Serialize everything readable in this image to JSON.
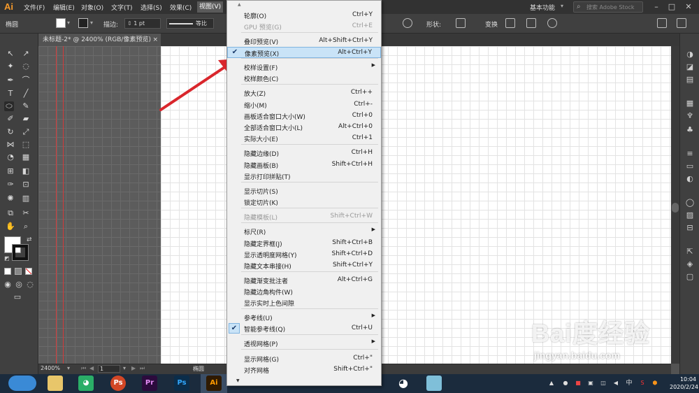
{
  "app": {
    "logo": "Ai",
    "workspace": "基本功能",
    "stock_placeholder": "搜索 Adobe Stock"
  },
  "menubar": {
    "items": [
      "文件(F)",
      "编辑(E)",
      "对象(O)",
      "文字(T)",
      "选择(S)",
      "效果(C)",
      "视图(V)"
    ],
    "active": "视图(V)"
  },
  "controlbar": {
    "object_label": "椭圆",
    "stroke_label": "描边:",
    "stroke_value": "1 pt",
    "stroke_profile": "等比",
    "shape_label": "形状:",
    "transform_label": "变换"
  },
  "document": {
    "tab_title": "未标题-2* @ 2400% (RGB/像素预览)",
    "close_glyph": "×"
  },
  "statusbar": {
    "zoom": "2400%",
    "page": "1",
    "tool": "椭圆"
  },
  "view_menu": {
    "items": [
      {
        "label": "轮廓(O)",
        "shortcut": "Ctrl+Y",
        "disabled": false
      },
      {
        "label": "GPU 预览(G)",
        "shortcut": "Ctrl+E",
        "disabled": true
      },
      {
        "label": "叠印预览(V)",
        "shortcut": "Alt+Shift+Ctrl+Y",
        "disabled": false
      },
      {
        "label": "像素预览(X)",
        "shortcut": "Alt+Ctrl+Y",
        "checked": true,
        "highlighted": true
      },
      {
        "label": "校样设置(F)",
        "submenu": true
      },
      {
        "label": "校样颜色(C)"
      },
      {
        "label": "放大(Z)",
        "shortcut": "Ctrl++"
      },
      {
        "label": "缩小(M)",
        "shortcut": "Ctrl+-"
      },
      {
        "label": "画板适合窗口大小(W)",
        "shortcut": "Ctrl+0"
      },
      {
        "label": "全部适合窗口大小(L)",
        "shortcut": "Alt+Ctrl+0"
      },
      {
        "label": "实际大小(E)",
        "shortcut": "Ctrl+1"
      },
      {
        "label": "隐藏边缘(D)",
        "shortcut": "Ctrl+H"
      },
      {
        "label": "隐藏画板(B)",
        "shortcut": "Shift+Ctrl+H"
      },
      {
        "label": "显示打印拼贴(T)"
      },
      {
        "label": "显示切片(S)"
      },
      {
        "label": "锁定切片(K)"
      },
      {
        "label": "隐藏模板(L)",
        "shortcut": "Shift+Ctrl+W",
        "disabled": true
      },
      {
        "label": "标尺(R)",
        "submenu": true
      },
      {
        "label": "隐藏定界框(J)",
        "shortcut": "Shift+Ctrl+B"
      },
      {
        "label": "显示透明度网格(Y)",
        "shortcut": "Shift+Ctrl+D"
      },
      {
        "label": "隐藏文本串接(H)",
        "shortcut": "Shift+Ctrl+Y"
      },
      {
        "label": "隐藏渐变批注者",
        "shortcut": "Alt+Ctrl+G"
      },
      {
        "label": "隐藏边角构件(W)"
      },
      {
        "label": "显示实时上色间隙"
      },
      {
        "label": "参考线(U)",
        "submenu": true
      },
      {
        "label": "智能参考线(Q)",
        "shortcut": "Ctrl+U",
        "checked": true
      },
      {
        "label": "透视网格(P)",
        "submenu": true
      },
      {
        "label": "显示网格(G)",
        "shortcut": "Ctrl+\""
      },
      {
        "label": "对齐网格",
        "shortcut": "Shift+Ctrl+\""
      }
    ],
    "checkmark": "✔",
    "submenu_glyph": "▶"
  },
  "taskbar": {
    "apps": [
      "Ps",
      "Pr",
      "Ps",
      "Ai"
    ],
    "time": "10:04",
    "date": "2020/2/24",
    "ime": "中"
  },
  "watermark": {
    "brand": "Bai度经验",
    "url": "jingyan.baidu.com"
  },
  "colors": {
    "accent": "#f79a2a",
    "highlight": "#c9e3f7",
    "arrow": "#d9262c"
  }
}
